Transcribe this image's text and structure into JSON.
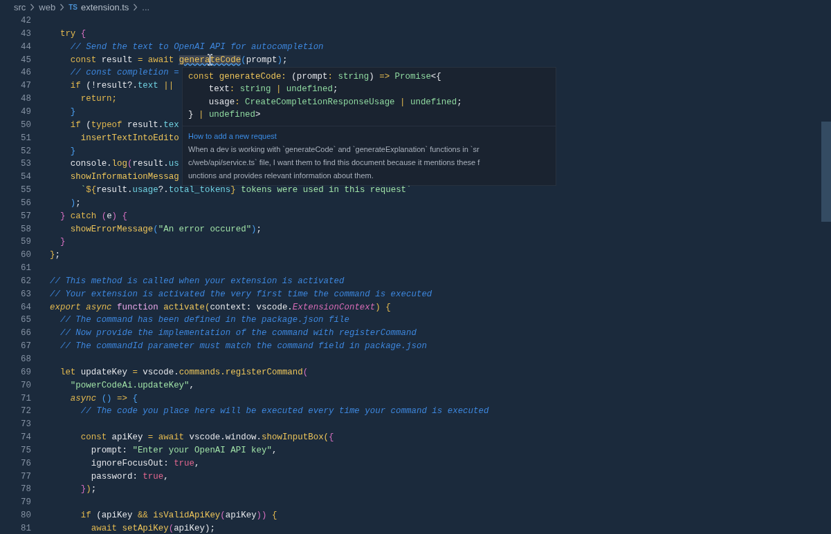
{
  "breadcrumb": {
    "items": [
      {
        "kind": "folder",
        "label": "src"
      },
      {
        "kind": "folder",
        "label": "web"
      },
      {
        "kind": "file",
        "badge": "TS",
        "label": "extension.ts"
      },
      {
        "kind": "more",
        "label": "..."
      }
    ]
  },
  "editor": {
    "lines": [
      {
        "number": "42"
      },
      {
        "number": "43",
        "tokens": [
          {
            "text": "  try",
            "kind": "keyword"
          },
          {
            "text": " {",
            "kind": "bracket_pink"
          }
        ]
      },
      {
        "number": "44",
        "tokens": [
          {
            "text": "    // Send the text to OpenAI API for autocompletion",
            "kind": "comment"
          }
        ]
      },
      {
        "number": "45",
        "tokens": [
          {
            "text": "    const",
            "kind": "keyword"
          },
          {
            "text": " result ",
            "kind": "plain"
          },
          {
            "text": "= await ",
            "kind": "keyword"
          },
          {
            "text": "generateCode",
            "kind": "hovered"
          },
          {
            "text": "(",
            "kind": "bracket_blue"
          },
          {
            "text": "prompt",
            "kind": "plain"
          },
          {
            "text": ")",
            "kind": "bracket_blue"
          },
          {
            "text": ";",
            "kind": "plain"
          }
        ]
      },
      {
        "number": "46",
        "tokens": [
          {
            "text": "    // const completion =",
            "kind": "comment"
          }
        ]
      },
      {
        "number": "47",
        "tokens": [
          {
            "text": "    if",
            "kind": "keyword"
          },
          {
            "text": " (!result?.",
            "kind": "plain"
          },
          {
            "text": "text",
            "kind": "property"
          },
          {
            "text": " ||",
            "kind": "keyword"
          }
        ]
      },
      {
        "number": "48",
        "tokens": [
          {
            "text": "      return;",
            "kind": "keyword"
          }
        ]
      },
      {
        "number": "49",
        "tokens": [
          {
            "text": "    }",
            "kind": "bracket_blue"
          }
        ]
      },
      {
        "number": "50",
        "tokens": [
          {
            "text": "    if",
            "kind": "keyword"
          },
          {
            "text": " (",
            "kind": "plain"
          },
          {
            "text": "typeof",
            "kind": "keyword"
          },
          {
            "text": " result.",
            "kind": "plain"
          },
          {
            "text": "tex",
            "kind": "property"
          }
        ]
      },
      {
        "number": "51",
        "tokens": [
          {
            "text": "      insertTextIntoEdito",
            "kind": "function"
          }
        ]
      },
      {
        "number": "52",
        "tokens": [
          {
            "text": "    }",
            "kind": "bracket_blue"
          }
        ]
      },
      {
        "number": "53",
        "tokens": [
          {
            "text": "    console.",
            "kind": "plain"
          },
          {
            "text": "log",
            "kind": "function"
          },
          {
            "text": "(",
            "kind": "bracket_pink"
          },
          {
            "text": "result.",
            "kind": "plain"
          },
          {
            "text": "us",
            "kind": "property"
          }
        ]
      },
      {
        "number": "54",
        "tokens": [
          {
            "text": "    showInformationMessag",
            "kind": "function"
          }
        ]
      },
      {
        "number": "55",
        "tokens": [
          {
            "text": "      `",
            "kind": "string"
          },
          {
            "text": "${",
            "kind": "keyword"
          },
          {
            "text": "result.",
            "kind": "plain"
          },
          {
            "text": "usage",
            "kind": "property"
          },
          {
            "text": "?.",
            "kind": "plain"
          },
          {
            "text": "total_tokens",
            "kind": "property"
          },
          {
            "text": "}",
            "kind": "keyword"
          },
          {
            "text": " tokens were used in this request`",
            "kind": "string"
          }
        ]
      },
      {
        "number": "56",
        "tokens": [
          {
            "text": "    )",
            "kind": "bracket_blue"
          },
          {
            "text": ";",
            "kind": "plain"
          }
        ]
      },
      {
        "number": "57",
        "tokens": [
          {
            "text": "  }",
            "kind": "bracket_pink"
          },
          {
            "text": " catch",
            "kind": "keyword"
          },
          {
            "text": " (",
            "kind": "bracket_pink"
          },
          {
            "text": "e",
            "kind": "plain"
          },
          {
            "text": ") {",
            "kind": "bracket_pink"
          }
        ]
      },
      {
        "number": "58",
        "tokens": [
          {
            "text": "    showErrorMessage",
            "kind": "function"
          },
          {
            "text": "(",
            "kind": "bracket_blue"
          },
          {
            "text": "\"An error occured\"",
            "kind": "string"
          },
          {
            "text": ")",
            "kind": "bracket_blue"
          },
          {
            "text": ";",
            "kind": "plain"
          }
        ]
      },
      {
        "number": "59",
        "tokens": [
          {
            "text": "  }",
            "kind": "bracket_pink"
          }
        ]
      },
      {
        "number": "60",
        "tokens": [
          {
            "text": "}",
            "kind": "keyword"
          },
          {
            "text": ";",
            "kind": "plain"
          }
        ]
      },
      {
        "number": "61"
      },
      {
        "number": "62",
        "tokens": [
          {
            "text": "// This method is called when your extension is activated",
            "kind": "comment"
          }
        ]
      },
      {
        "number": "63",
        "tokens": [
          {
            "text": "// Your extension is activated the very first time the command is executed",
            "kind": "comment"
          }
        ]
      },
      {
        "number": "64",
        "tokens": [
          {
            "text": "export async",
            "kind": "keyword_italic"
          },
          {
            "text": " function",
            "kind": "storage"
          },
          {
            "text": " activate(",
            "kind": "function"
          },
          {
            "text": "context: vscode.",
            "kind": "plain"
          },
          {
            "text": "ExtensionContext",
            "kind": "type"
          },
          {
            "text": ") {",
            "kind": "keyword"
          }
        ]
      },
      {
        "number": "65",
        "tokens": [
          {
            "text": "  // The command has been defined in the package.json file",
            "kind": "comment"
          }
        ]
      },
      {
        "number": "66",
        "tokens": [
          {
            "text": "  // Now provide the implementation of the command with registerCommand",
            "kind": "comment"
          }
        ]
      },
      {
        "number": "67",
        "tokens": [
          {
            "text": "  // The commandId parameter must match the command field in package.json",
            "kind": "comment"
          }
        ]
      },
      {
        "number": "68"
      },
      {
        "number": "69",
        "tokens": [
          {
            "text": "  let",
            "kind": "keyword"
          },
          {
            "text": " updateKey ",
            "kind": "plain"
          },
          {
            "text": "=",
            "kind": "keyword"
          },
          {
            "text": " vscode.",
            "kind": "plain"
          },
          {
            "text": "commands.registerCommand",
            "kind": "function"
          },
          {
            "text": "(",
            "kind": "bracket_pink"
          }
        ]
      },
      {
        "number": "70",
        "tokens": [
          {
            "text": "    \"powerCodeAi.updateKey\"",
            "kind": "string"
          },
          {
            "text": ",",
            "kind": "plain"
          }
        ]
      },
      {
        "number": "71",
        "tokens": [
          {
            "text": "    async",
            "kind": "keyword_italic"
          },
          {
            "text": " ()",
            "kind": "bracket_blue"
          },
          {
            "text": " =>",
            "kind": "keyword"
          },
          {
            "text": " {",
            "kind": "bracket_blue"
          }
        ]
      },
      {
        "number": "72",
        "tokens": [
          {
            "text": "      // The code you place here will be executed every time your command is executed",
            "kind": "comment"
          }
        ]
      },
      {
        "number": "73"
      },
      {
        "number": "74",
        "tokens": [
          {
            "text": "      const",
            "kind": "keyword"
          },
          {
            "text": " apiKey ",
            "kind": "plain"
          },
          {
            "text": "= await",
            "kind": "keyword"
          },
          {
            "text": " vscode.window.",
            "kind": "plain"
          },
          {
            "text": "showInputBox(",
            "kind": "function"
          },
          {
            "text": "{",
            "kind": "bracket_pink"
          }
        ]
      },
      {
        "number": "75",
        "tokens": [
          {
            "text": "        prompt: ",
            "kind": "plain"
          },
          {
            "text": "\"Enter your OpenAI API key\"",
            "kind": "string"
          },
          {
            "text": ",",
            "kind": "plain"
          }
        ]
      },
      {
        "number": "76",
        "tokens": [
          {
            "text": "        ignoreFocusOut: ",
            "kind": "plain"
          },
          {
            "text": "true",
            "kind": "boolean"
          },
          {
            "text": ",",
            "kind": "plain"
          }
        ]
      },
      {
        "number": "77",
        "tokens": [
          {
            "text": "        password: ",
            "kind": "plain"
          },
          {
            "text": "true",
            "kind": "boolean"
          },
          {
            "text": ",",
            "kind": "plain"
          }
        ]
      },
      {
        "number": "78",
        "tokens": [
          {
            "text": "      }",
            "kind": "bracket_pink"
          },
          {
            "text": ")",
            "kind": "keyword"
          },
          {
            "text": ";",
            "kind": "plain"
          }
        ]
      },
      {
        "number": "79"
      },
      {
        "number": "80",
        "tokens": [
          {
            "text": "      if",
            "kind": "keyword"
          },
          {
            "text": " (apiKey ",
            "kind": "plain"
          },
          {
            "text": "&&",
            "kind": "keyword"
          },
          {
            "text": " isValidApiKey",
            "kind": "function"
          },
          {
            "text": "(",
            "kind": "bracket_pink"
          },
          {
            "text": "apiKey",
            "kind": "plain"
          },
          {
            "text": "))",
            "kind": "bracket_pink"
          },
          {
            "text": " {",
            "kind": "keyword"
          }
        ]
      },
      {
        "number": "81",
        "tokens": [
          {
            "text": "        await",
            "kind": "keyword"
          },
          {
            "text": " setApiKey",
            "kind": "function"
          },
          {
            "text": "(",
            "kind": "bracket_pink"
          },
          {
            "text": "apiKey",
            "kind": "plain"
          },
          {
            "text": ");",
            "kind": "plain"
          }
        ]
      }
    ]
  },
  "hover_tooltip": {
    "signature": [
      [
        {
          "text": "const",
          "kind": "keyword"
        },
        {
          "text": " generateCode:",
          "kind": "function"
        },
        {
          "text": " (prompt",
          "kind": "plain"
        },
        {
          "text": ":",
          "kind": "keyword"
        },
        {
          "text": " string",
          "kind": "typename"
        },
        {
          "text": ") ",
          "kind": "plain"
        },
        {
          "text": "=>",
          "kind": "keyword"
        },
        {
          "text": " Promise",
          "kind": "typename"
        },
        {
          "text": "<{",
          "kind": "plain"
        }
      ],
      [
        {
          "text": "    text",
          "kind": "plain"
        },
        {
          "text": ":",
          "kind": "keyword"
        },
        {
          "text": " string ",
          "kind": "typename"
        },
        {
          "text": "|",
          "kind": "keyword"
        },
        {
          "text": " undefined",
          "kind": "typename"
        },
        {
          "text": ";",
          "kind": "plain"
        }
      ],
      [
        {
          "text": "    usage",
          "kind": "plain"
        },
        {
          "text": ":",
          "kind": "keyword"
        },
        {
          "text": " CreateCompletionResponseUsage ",
          "kind": "typename"
        },
        {
          "text": "|",
          "kind": "keyword"
        },
        {
          "text": " undefined",
          "kind": "typename"
        },
        {
          "text": ";",
          "kind": "plain"
        }
      ],
      [
        {
          "text": "}",
          "kind": "plain"
        },
        {
          "text": " | ",
          "kind": "keyword"
        },
        {
          "text": "undefined",
          "kind": "typename"
        },
        {
          "text": ">",
          "kind": "plain"
        }
      ]
    ],
    "link": "How to add a new request",
    "description_lines": [
      "When a dev is working with `generateCode` and `generateExplanation` functions in `sr",
      "c/web/api/service.ts` file, I want them to find this document because it mentions these f",
      "unctions and provides relevant information about them."
    ]
  }
}
